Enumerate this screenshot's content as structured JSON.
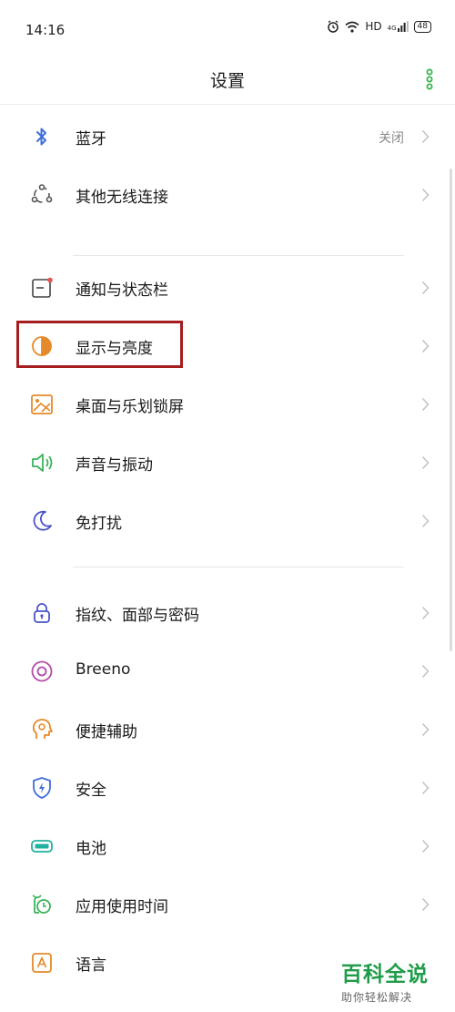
{
  "status_bar": {
    "time": "14:16",
    "network": "HD",
    "signal": "4G",
    "battery": "48"
  },
  "header": {
    "title": "设置"
  },
  "settings": {
    "bluetooth": {
      "label": "蓝牙",
      "value": "关闭"
    },
    "other_wireless": {
      "label": "其他无线连接"
    },
    "notifications": {
      "label": "通知与状态栏"
    },
    "display": {
      "label": "显示与亮度"
    },
    "desktop": {
      "label": "桌面与乐划锁屏"
    },
    "sound": {
      "label": "声音与振动"
    },
    "dnd": {
      "label": "免打扰"
    },
    "fingerprint": {
      "label": "指纹、面部与密码"
    },
    "breeno": {
      "label": "Breeno"
    },
    "accessibility": {
      "label": "便捷辅助"
    },
    "security": {
      "label": "安全"
    },
    "battery": {
      "label": "电池"
    },
    "app_usage": {
      "label": "应用使用时间"
    },
    "language": {
      "label": "语言"
    }
  },
  "watermark": {
    "title": "百科全说",
    "subtitle": "助你轻松解决"
  },
  "colors": {
    "accent_green": "#35b34a",
    "highlight_red": "#a51d1d",
    "blue_icon": "#3f6fd9",
    "orange_icon": "#e58a2a"
  }
}
